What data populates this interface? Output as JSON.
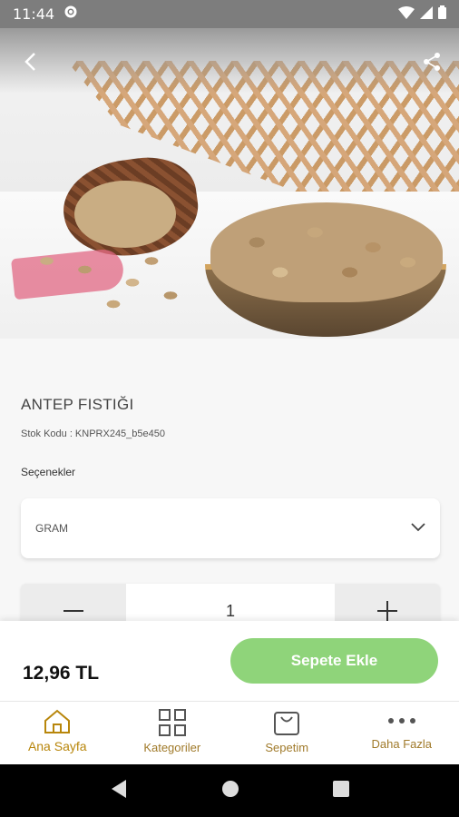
{
  "status_bar": {
    "time": "11:44"
  },
  "product": {
    "title": "ANTEP FISTIĞI",
    "sku_line": "Stok Kodu : KNPRX245_b5e450",
    "options_label": "Seçenekler",
    "option_selected": "GRAM",
    "quantity": "1",
    "price": "12,96 TL"
  },
  "actions": {
    "add_to_cart": "Sepete Ekle"
  },
  "tabs": [
    {
      "label": "Ana Sayfa",
      "icon": "home-icon"
    },
    {
      "label": "Kategoriler",
      "icon": "grid-icon"
    },
    {
      "label": "Sepetim",
      "icon": "cart-icon"
    },
    {
      "label": "Daha Fazla",
      "icon": "more-icon"
    }
  ],
  "colors": {
    "accent": "#b8860b",
    "button_green": "#8fd47a",
    "status_bar": "#7d7d7d"
  }
}
